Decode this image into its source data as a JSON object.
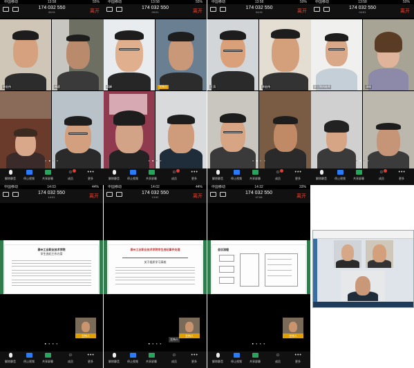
{
  "meeting": {
    "number": "174 032 550",
    "leave_label": "离开",
    "carrier": "中国移动"
  },
  "toolbar": {
    "items": [
      "解除静音",
      "停止视频",
      "共享屏幕",
      "成员",
      "更多"
    ]
  },
  "screens": [
    {
      "time": "13:58",
      "battery": "55%",
      "timer": "09:01",
      "tiles": [
        {
          "name": "李宏伟"
        },
        {
          "name": "杨超"
        },
        {
          "name": "蒋峰"
        },
        {
          "name": "主持人",
          "speaker": true
        },
        {
          "name": ""
        },
        {
          "name": ""
        },
        {
          "name": ""
        },
        {
          "name": ""
        }
      ]
    },
    {
      "time": "13:58",
      "battery": "50%",
      "timer": "04:51",
      "tiles": [
        {
          "name": "王涛"
        },
        {
          "name": "李宏伟"
        },
        {
          "name": "学工院刘老师"
        },
        {
          "name": "汤瑶"
        },
        {
          "name": ""
        },
        {
          "name": ""
        },
        {
          "name": ""
        },
        {
          "name": ""
        }
      ]
    },
    {
      "time": "14:03",
      "battery": "44%",
      "timer": "14:01",
      "selfview": "主持人"
    },
    {
      "time": "14:02",
      "battery": "44%",
      "timer": "13:52",
      "selfview": "主持人",
      "tooltip": "主持人"
    },
    {
      "time": "14:32",
      "battery": "33%",
      "timer": "47:08",
      "selfview": "主持人"
    }
  ],
  "docs": {
    "d1": {
      "heading": "泰州工业职业技术学院",
      "sub": "学生违纪工作方案"
    },
    "d2": {
      "heading": "泰州工业职业技术学院学生违纪事件处理",
      "sub": "关于组织学习高校"
    },
    "d3": {
      "heading": "会议流程"
    }
  },
  "colors": {
    "accent_red": "#e8412f",
    "toolbar_blue": "#2a7cf6",
    "share_green": "#26a65b",
    "speaker_tag": "#e1a000"
  }
}
